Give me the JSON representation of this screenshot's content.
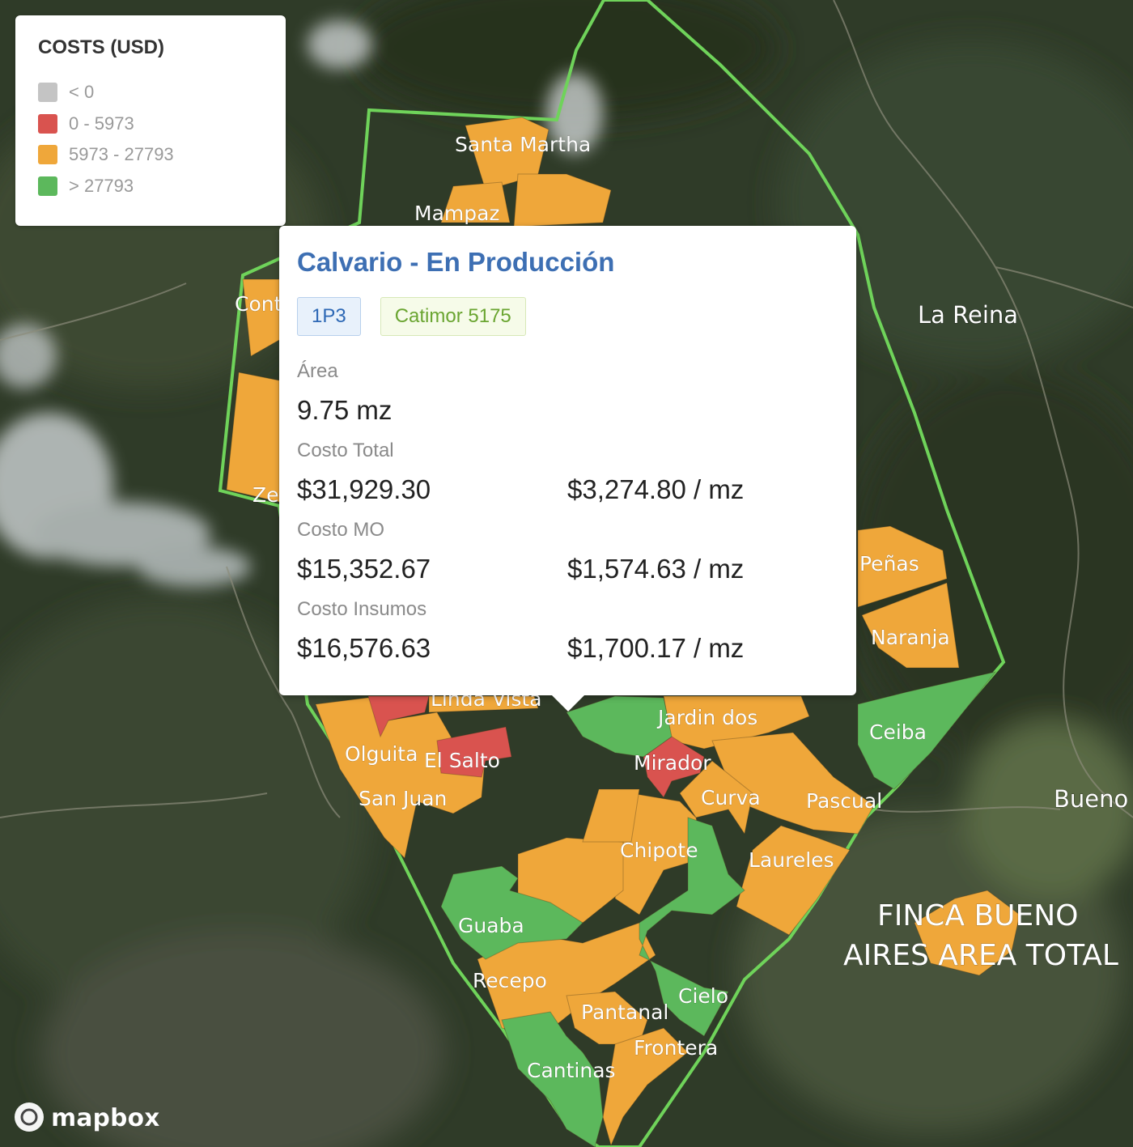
{
  "map": {
    "plot_labels": [
      "Santa Martha",
      "Mampaz",
      "Cont",
      "Zel",
      "Peñas",
      "Naranja",
      "Ceiba",
      "Linda Vista",
      "Jardin dos",
      "Olguita",
      "El Salto",
      "Mirador",
      "San Juan",
      "Curva",
      "Pascual",
      "Chipote",
      "Laureles",
      "Guaba",
      "Recepo",
      "Cielo",
      "Pantanal",
      "Frontera",
      "Cantinas"
    ],
    "place_labels": [
      "La Reina",
      "Bueno"
    ],
    "area_label_lines": [
      "FINCA BUENO",
      "AIRES AREA TOTAL"
    ],
    "attribution": "mapbox",
    "colors": {
      "negative": "#c4c4c4",
      "low": "#d9534f",
      "mid": "#efa73a",
      "high": "#5cb85c",
      "boundary": "#6fd35a"
    }
  },
  "legend": {
    "title": "COSTS (USD)",
    "items": [
      {
        "label": "< 0",
        "color": "#c4c4c4"
      },
      {
        "label": "0 - 5973",
        "color": "#d9534f"
      },
      {
        "label": "5973 - 27793",
        "color": "#efa73a"
      },
      {
        "label": "> 27793",
        "color": "#5cb85c"
      }
    ]
  },
  "popup": {
    "title": "Calvario - En Producción",
    "tags": [
      "1P3",
      "Catimor 5175"
    ],
    "area_label": "Área",
    "area_value": "9.75 mz",
    "total_label": "Costo Total",
    "total_value": "$31,929.30",
    "total_per_mz": "$3,274.80 / mz",
    "mo_label": "Costo MO",
    "mo_value": "$15,352.67",
    "mo_per_mz": "$1,574.63 / mz",
    "insumos_label": "Costo Insumos",
    "insumos_value": "$16,576.63",
    "insumos_per_mz": "$1,700.17 / mz"
  }
}
